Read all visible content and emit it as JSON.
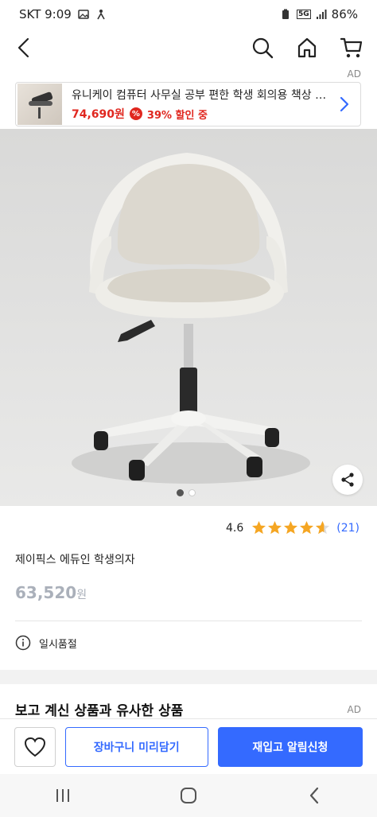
{
  "status_bar": {
    "carrier_time": "SKT 9:09",
    "battery": "86%",
    "network": "5G"
  },
  "top_nav": {
    "back_icon": "chevron-left-icon",
    "search_icon": "search-icon",
    "home_icon": "home-icon",
    "cart_icon": "cart-icon"
  },
  "ad_banner": {
    "label": "AD",
    "title": "유니케이 컴퓨터 사무실 공부 편한 학생 회의용 책상 의자",
    "price": "74,690원",
    "discount_badge": "%",
    "discount_text": "39% 할인 중"
  },
  "gallery": {
    "active_index": 0,
    "total": 2
  },
  "rating": {
    "value": "4.6",
    "stars": 4.6,
    "count": "(21)"
  },
  "product": {
    "name": "제이픽스 에듀인 학생의자",
    "price": "63,520",
    "price_unit": "원",
    "stock_status": "일시품절"
  },
  "similar_section": {
    "title": "보고 계신 상품과 유사한 상품",
    "ad_label": "AD"
  },
  "action_bar": {
    "cart_label": "장바구니 미리담기",
    "notify_label": "재입고 알림신청"
  },
  "colors": {
    "accent_blue": "#346aff",
    "sale_red": "#e0271f",
    "star_orange": "#f5a623",
    "muted_price": "#aab0ba"
  }
}
